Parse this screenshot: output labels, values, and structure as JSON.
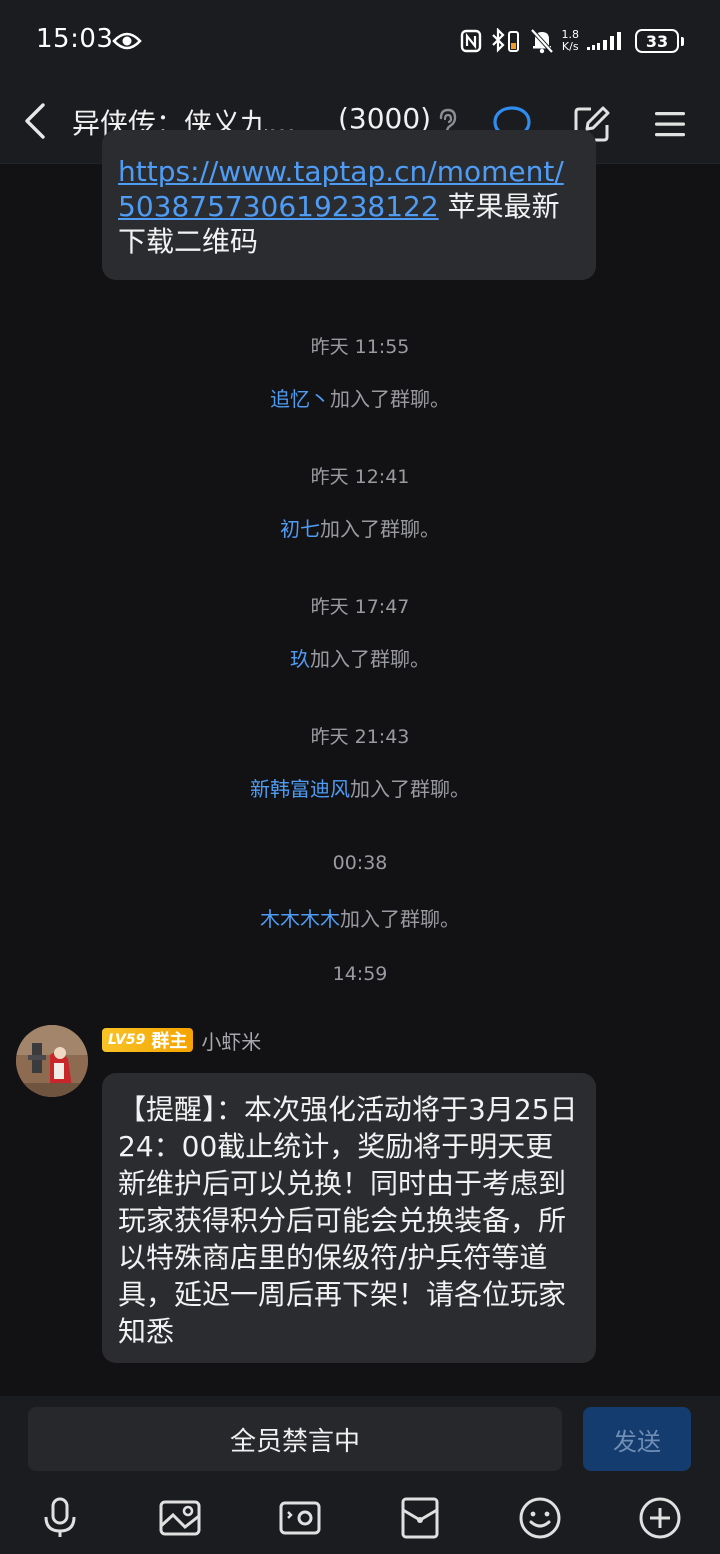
{
  "status_bar": {
    "time": "15:03",
    "net_speed_value": "1.8",
    "net_speed_unit": "K/s",
    "battery": "33"
  },
  "header": {
    "title": "异侠传：侠义九…",
    "member_count": "(3000)"
  },
  "top_message": {
    "link_text": "https://www.taptap.cn/moment/503875730619238122",
    "trailing_text": " 苹果最新下载二维码"
  },
  "events": [
    {
      "time": "昨天 11:55",
      "name": "追忆丶",
      "action": "加入了群聊。"
    },
    {
      "time": "昨天 12:41",
      "name": "初七",
      "action": "加入了群聊。"
    },
    {
      "time": "昨天 17:47",
      "name": "玖",
      "action": "加入了群聊。"
    },
    {
      "time": "昨天 21:43",
      "name": "新韩富迪风",
      "action": "加入了群聊。"
    },
    {
      "time": "00:38",
      "name": "木木木木",
      "action": "加入了群聊。"
    }
  ],
  "last_timestamp": "14:59",
  "message": {
    "level": "LV59",
    "role": "群主",
    "sender": "小虾米",
    "text": "【提醒】：本次强化活动将于3月25日24：00截止统计，奖励将于明天更新维护后可以兑换！同时由于考虑到玩家获得积分后可能会兑换装备，所以特殊商店里的保级符/护兵符等道具，延迟一周后再下架！请各位玩家知悉"
  },
  "input": {
    "muted_text": "全员禁言中",
    "send_label": "发送"
  },
  "toolbar_icons": [
    "microphone-icon",
    "image-icon",
    "video-icon",
    "red-packet-icon",
    "emoji-icon",
    "plus-icon"
  ],
  "colors": {
    "background": "#121214",
    "bar": "#1b1c1f",
    "bubble": "#2b2c30",
    "accent": "#2f8cf0",
    "link": "#4f9cf5",
    "badge": "#f8c326"
  }
}
